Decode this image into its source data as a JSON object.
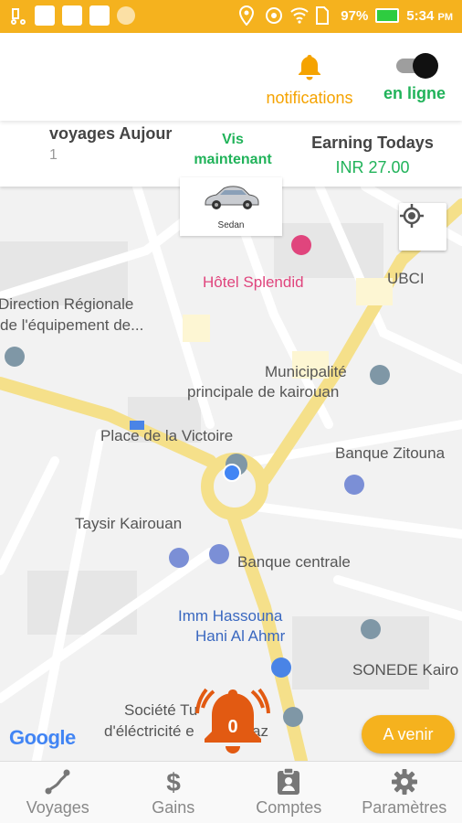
{
  "status_bar": {
    "battery": "97%",
    "time": "5:34",
    "time_suffix": "PM"
  },
  "header": {
    "notifications_label": "notifications",
    "online_label": "en ligne",
    "online_toggle": true
  },
  "stats": {
    "trips_title": "voyages Aujour",
    "trips_count": "1",
    "view_now_line1": "Vis",
    "view_now_line2": "maintenant",
    "earning_title": "Earning Todays",
    "earning_value": "INR 27.00"
  },
  "car_card": {
    "label": "Sedan"
  },
  "map": {
    "pois": {
      "hotel": "Hôtel Splendid",
      "ubci": "UBCI",
      "direction_1": "Direction Régionale",
      "direction_2": "de l'équipement de...",
      "municipalite_1": "Municipalité",
      "municipalite_2": "principale de kairouan",
      "place": "Place de la Victoire",
      "zitouna": "Banque Zitouna",
      "taysir": "Taysir Kairouan",
      "centrale": "Banque centrale",
      "hassouna_1": "Imm Hassouna",
      "hassouna_2": "Hani Al Ahmr",
      "sonede": "SONEDE Kairo",
      "societe_1": "Société Tu",
      "societe_2": "d'éléctricité e",
      "societe_3": "az"
    },
    "google_logo": "Google",
    "alert_count": "0",
    "upcoming_button": "A venir"
  },
  "bottom_nav": {
    "items": [
      {
        "label": "Voyages",
        "icon": "route-icon"
      },
      {
        "label": "Gains",
        "icon": "dollar-icon"
      },
      {
        "label": "Comptes",
        "icon": "account-badge-icon"
      },
      {
        "label": "Paramètres",
        "icon": "gear-icon"
      }
    ]
  },
  "colors": {
    "accent": "#f5b21e",
    "online_green": "#21b35a",
    "alert_orange": "#e25a12"
  }
}
